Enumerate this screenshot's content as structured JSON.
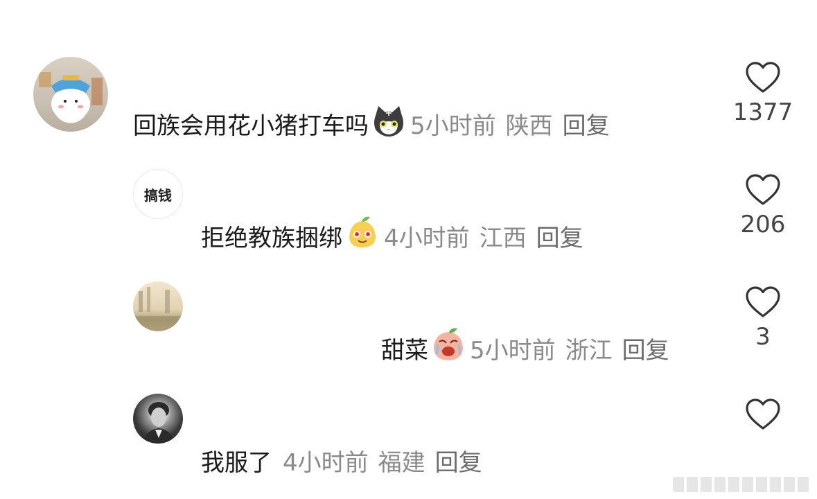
{
  "comments": [
    {
      "text": "回族会用花小猪打车吗",
      "emoji": "cat-face-emoji",
      "time": "5小时前",
      "location": "陕西",
      "reply_label": "回复",
      "likes": "1377"
    },
    {
      "avatar_text": "搞钱",
      "text": "拒绝教族捆绑",
      "emoji": "smug-pear-emoji",
      "time": "4小时前",
      "location": "江西",
      "reply_label": "回复",
      "likes": "206"
    },
    {
      "text": "甜菜",
      "emoji": "crying-peach-emoji",
      "time": "5小时前",
      "location": "浙江",
      "reply_label": "回复",
      "likes": "3"
    },
    {
      "text": "我服了",
      "time": "4小时前",
      "location": "福建",
      "reply_label": "回复"
    }
  ],
  "colors": {
    "text": "#1a1a1a",
    "meta": "#8a8a8a",
    "heart": "#333333"
  }
}
